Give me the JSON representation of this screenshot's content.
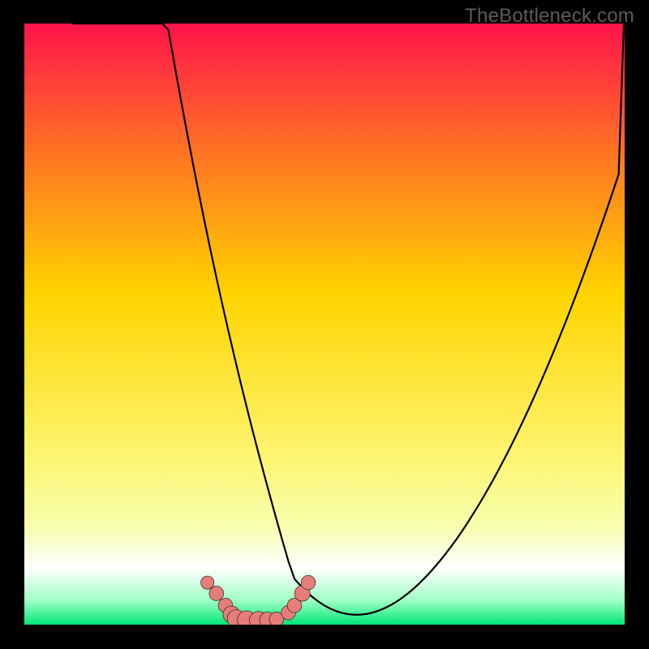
{
  "watermark": "TheBottleneck.com",
  "colors": {
    "background": "#000000",
    "curve": "#000000",
    "marker_fill": "#e77d78",
    "marker_stroke": "#111111"
  },
  "chart_data": {
    "type": "line",
    "title": "",
    "xlabel": "",
    "ylabel": "",
    "xlim": [
      0,
      100
    ],
    "ylim": [
      0,
      100
    ],
    "x": [
      0,
      1,
      2,
      3,
      4,
      5,
      6,
      7,
      8,
      9,
      10,
      11,
      12,
      13,
      14,
      15,
      16,
      17,
      18,
      19,
      20,
      21,
      22,
      23,
      24,
      25,
      26,
      27,
      28,
      29,
      30,
      31,
      32,
      33,
      34,
      35,
      36,
      37,
      38,
      39,
      40,
      41,
      42,
      43,
      44,
      45,
      46,
      47,
      48,
      49,
      50,
      51,
      52,
      53,
      54,
      55,
      56,
      57,
      58,
      59,
      60,
      61,
      62,
      63,
      64,
      65,
      66,
      67,
      68,
      69,
      70,
      71,
      72,
      73,
      74,
      75,
      76,
      77,
      78,
      79,
      80,
      81,
      82,
      83,
      84,
      85,
      86,
      87,
      88,
      89,
      90,
      91,
      92,
      93,
      94,
      95,
      96,
      97,
      98,
      99,
      100
    ],
    "values": [
      307.68,
      133.98,
      128.64,
      123.3,
      118.11,
      113.07,
      108.19,
      103.34,
      98.66,
      94.54,
      90.56,
      86.72,
      82.96,
      79.36,
      75.82,
      72.43,
      69.12,
      65.89,
      62.74,
      59.67,
      56.68,
      53.77,
      50.94,
      48.19,
      45.5,
      42.9,
      40.35,
      37.89,
      35.49,
      33.16,
      30.89,
      28.69,
      26.55,
      24.47,
      22.46,
      20.49,
      18.58,
      16.72,
      14.9,
      13.13,
      11.4,
      9.71,
      8.05,
      6.42,
      4.83,
      3.51,
      2.98,
      2.51,
      2.11,
      1.76,
      1.46,
      1.22,
      1.03,
      0.89,
      0.8,
      0.76,
      0.77,
      0.82,
      0.92,
      1.07,
      1.26,
      1.49,
      1.76,
      2.08,
      2.43,
      2.82,
      3.25,
      3.72,
      4.22,
      4.75,
      5.32,
      5.92,
      6.55,
      7.22,
      7.92,
      8.65,
      9.4,
      10.19,
      11.0,
      11.85,
      12.72,
      13.62,
      14.55,
      15.51,
      16.49,
      17.51,
      18.55,
      19.61,
      20.71,
      21.83,
      22.97,
      24.15,
      25.35,
      26.58,
      27.83,
      29.1,
      30.41,
      31.73,
      33.09,
      34.46,
      167.06
    ],
    "gradient_stops": [
      {
        "offset": 0.0,
        "color": "#ff144b"
      },
      {
        "offset": 0.2,
        "color": "#ff6d25"
      },
      {
        "offset": 0.45,
        "color": "#ffd400"
      },
      {
        "offset": 0.72,
        "color": "#fdf570"
      },
      {
        "offset": 0.84,
        "color": "#f7ffb0"
      },
      {
        "offset": 0.905,
        "color": "#ffffff"
      },
      {
        "offset": 0.96,
        "color": "#9fffc4"
      },
      {
        "offset": 1.0,
        "color": "#00e676"
      }
    ],
    "markers": [
      {
        "x": 30.5,
        "y": 93.0,
        "r": 1.1
      },
      {
        "x": 32.0,
        "y": 94.8,
        "r": 1.2
      },
      {
        "x": 33.5,
        "y": 96.8,
        "r": 1.2
      },
      {
        "x": 34.5,
        "y": 98.3,
        "r": 1.4
      },
      {
        "x": 35.3,
        "y": 99.0,
        "r": 1.5
      },
      {
        "x": 37.0,
        "y": 99.2,
        "r": 1.5
      },
      {
        "x": 39.0,
        "y": 99.3,
        "r": 1.5
      },
      {
        "x": 40.5,
        "y": 99.2,
        "r": 1.3
      },
      {
        "x": 42.0,
        "y": 99.1,
        "r": 1.2
      },
      {
        "x": 44.0,
        "y": 98.0,
        "r": 1.2
      },
      {
        "x": 45.0,
        "y": 96.8,
        "r": 1.2
      },
      {
        "x": 46.3,
        "y": 94.8,
        "r": 1.3
      },
      {
        "x": 47.3,
        "y": 93.0,
        "r": 1.2
      }
    ]
  }
}
